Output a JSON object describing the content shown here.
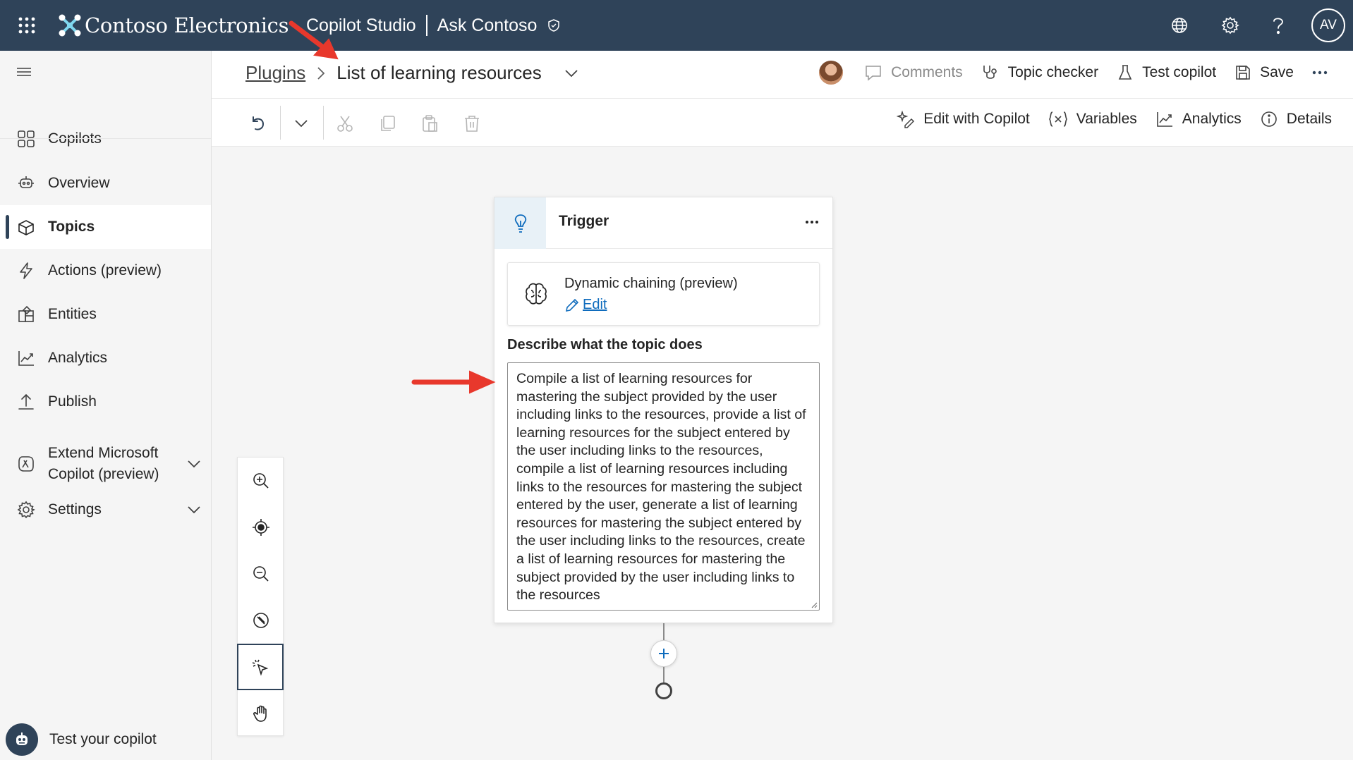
{
  "topbar": {
    "brand": "Contoso Electronics",
    "product": "Copilot Studio",
    "copilot_name": "Ask Contoso",
    "user_initials": "AV"
  },
  "sidebar": {
    "items": [
      {
        "label": "Copilots",
        "icon": "grid-icon"
      },
      {
        "label": "Overview",
        "icon": "overview-icon"
      },
      {
        "label": "Topics",
        "icon": "topics-icon",
        "active": true
      },
      {
        "label": "Actions (preview)",
        "icon": "lightning-icon"
      },
      {
        "label": "Entities",
        "icon": "entities-icon"
      },
      {
        "label": "Analytics",
        "icon": "analytics-icon"
      },
      {
        "label": "Publish",
        "icon": "publish-icon"
      },
      {
        "label_line1": "Extend Microsoft",
        "label_line2": "Copilot (preview)",
        "icon": "extend-icon"
      },
      {
        "label": "Settings",
        "icon": "gear-icon"
      }
    ],
    "test_label": "Test your copilot"
  },
  "header": {
    "breadcrumb_parent": "Plugins",
    "topic_title": "List of learning resources",
    "comments": "Comments",
    "topic_checker": "Topic checker",
    "test_copilot": "Test copilot",
    "save": "Save"
  },
  "toolbar": {
    "edit_with_copilot": "Edit with Copilot",
    "variables": "Variables",
    "analytics": "Analytics",
    "details": "Details"
  },
  "trigger": {
    "title": "Trigger",
    "dynamic_chaining": "Dynamic chaining (preview)",
    "edit": "Edit",
    "describe_label": "Describe what the topic does",
    "description": "Compile a list of learning resources for mastering the subject provided by the user including links to the resources, provide a list of learning resources for the subject entered by the user including links to the resources, compile a list of learning resources including links to the resources for mastering the subject entered by the user, generate a list of learning resources for mastering the subject entered by the user including links to the resources, create a list of learning resources for mastering the subject provided by the user including links to the resources"
  },
  "colors": {
    "topbar": "#2f4359",
    "accent": "#0f6cbd",
    "annotation_arrow": "#e8382c"
  }
}
